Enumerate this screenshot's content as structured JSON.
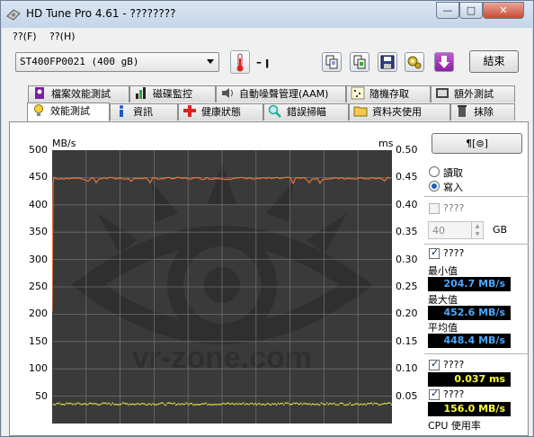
{
  "window": {
    "title": "HD Tune Pro 4.61 - ????????",
    "minimize": "—",
    "maximize": "□",
    "close": "✕"
  },
  "menu": {
    "file": "??(F)",
    "help": "??(H)"
  },
  "toolbar": {
    "drive": "ST400FP0021 (400 gB)",
    "temperature": "– ꞁ",
    "exit_label": "結束",
    "icons": [
      "copy-icon",
      "copy-info-icon",
      "save-icon",
      "options-icon",
      "download-icon"
    ]
  },
  "tabs_row1": [
    {
      "label": "檔案效能測試",
      "icon": "file-benchmark-icon"
    },
    {
      "label": "磁碟監控",
      "icon": "disk-monitor-icon"
    },
    {
      "label": "自動噪聲管理(AAM)",
      "icon": "speaker-icon"
    },
    {
      "label": "隨機存取",
      "icon": "random-access-icon"
    },
    {
      "label": "額外測試",
      "icon": "extra-tests-icon"
    }
  ],
  "tabs_row2": [
    {
      "label": "效能測試",
      "icon": "benchmark-icon",
      "active": true
    },
    {
      "label": "資訊",
      "icon": "info-icon"
    },
    {
      "label": "健康狀態",
      "icon": "health-icon"
    },
    {
      "label": "錯誤掃瞄",
      "icon": "error-scan-icon"
    },
    {
      "label": "資料夾使用",
      "icon": "folder-usage-icon"
    },
    {
      "label": "抹除",
      "icon": "erase-icon"
    }
  ],
  "chart": {
    "left_unit": "MB/s",
    "right_unit": "ms",
    "left_ticks": [
      "500",
      "450",
      "400",
      "350",
      "300",
      "250",
      "200",
      "150",
      "100",
      "50"
    ],
    "right_ticks": [
      "0.50",
      "0.45",
      "0.40",
      "0.35",
      "0.30",
      "0.25",
      "0.20",
      "0.15",
      "0.10",
      "0.05"
    ],
    "watermark": "vr-zone.com"
  },
  "chart_data": {
    "type": "line",
    "ylim_left": [
      0,
      500
    ],
    "ylim_right": [
      0,
      0.5
    ],
    "grid": true,
    "series": [
      {
        "name": "",
        "axis": "left",
        "color": "#e8743a",
        "approx_value": 448.4
      },
      {
        "name": "",
        "axis": "right",
        "color": "#e6e64a",
        "approx_value": 0.037
      }
    ]
  },
  "side": {
    "start_button": "¶[⊜]",
    "read_label": "讀取",
    "write_label": "寫入",
    "short_stroke_label": "????",
    "gb_value": "40",
    "gb_unit": "GB",
    "transfer_label": "????",
    "min_label": "最小值",
    "min_value": "204.7 MB/s",
    "max_label": "最大值",
    "max_value": "452.6 MB/s",
    "avg_label": "平均值",
    "avg_value": "448.4 MB/s",
    "access_label": "????",
    "access_value": "0.037 ms",
    "burst_label": "????",
    "burst_value": "156.0 MB/s",
    "cpu_label": "CPU 使用率",
    "colors": {
      "blue_readout": "#4aa8ff",
      "yellow_readout": "#ffff3a"
    }
  }
}
